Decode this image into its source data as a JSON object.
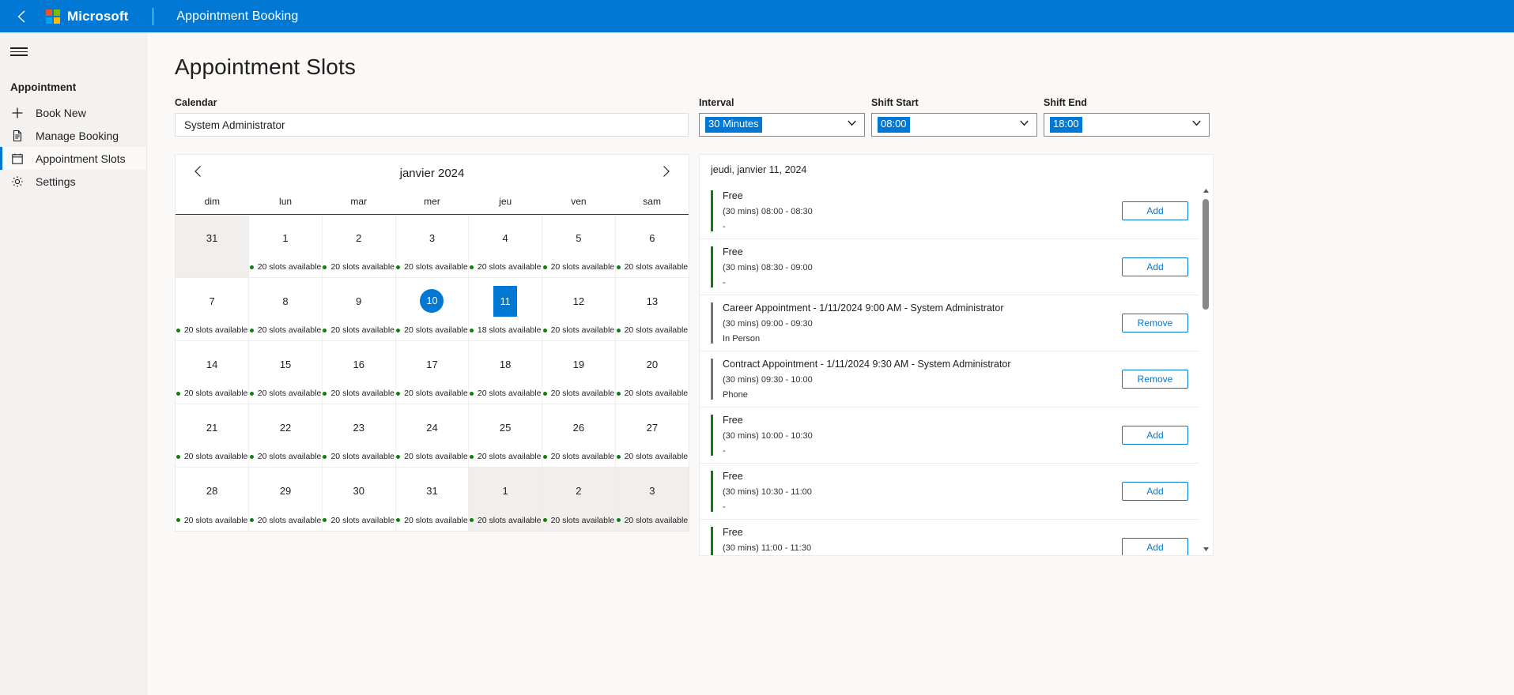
{
  "topbar": {
    "back_icon": "chevron-left-icon",
    "brand": "Microsoft",
    "app_title": "Appointment Booking"
  },
  "sidebar": {
    "menu_icon": "hamburger-menu-icon",
    "group_title": "Appointment",
    "items": [
      {
        "label": "Book New",
        "icon": "plus-icon",
        "active": false
      },
      {
        "label": "Manage Booking",
        "icon": "document-icon",
        "active": false
      },
      {
        "label": "Appointment Slots",
        "icon": "calendar-icon",
        "active": true
      },
      {
        "label": "Settings",
        "icon": "gear-icon",
        "active": false
      }
    ]
  },
  "page": {
    "title": "Appointment Slots"
  },
  "controls": {
    "calendar": {
      "label": "Calendar",
      "value": "System Administrator"
    },
    "interval": {
      "label": "Interval",
      "value": "30 Minutes"
    },
    "shift_start": {
      "label": "Shift Start",
      "value": "08:00"
    },
    "shift_end": {
      "label": "Shift End",
      "value": "18:00"
    }
  },
  "calendar": {
    "month_label": "janvier 2024",
    "prev_icon": "chevron-left-icon",
    "next_icon": "chevron-right-icon",
    "weekdays": [
      "dim",
      "lun",
      "mar",
      "mer",
      "jeu",
      "ven",
      "sam"
    ],
    "slots_text_default": "20 slots available",
    "weeks": [
      [
        {
          "day": "31",
          "othermonth": true,
          "slots": ""
        },
        {
          "day": "1",
          "othermonth": false,
          "slots": "20 slots available"
        },
        {
          "day": "2",
          "othermonth": false,
          "slots": "20 slots available"
        },
        {
          "day": "3",
          "othermonth": false,
          "slots": "20 slots available"
        },
        {
          "day": "4",
          "othermonth": false,
          "slots": "20 slots available"
        },
        {
          "day": "5",
          "othermonth": false,
          "slots": "20 slots available"
        },
        {
          "day": "6",
          "othermonth": false,
          "slots": "20 slots available"
        }
      ],
      [
        {
          "day": "7",
          "othermonth": false,
          "slots": "20 slots available"
        },
        {
          "day": "8",
          "othermonth": false,
          "slots": "20 slots available"
        },
        {
          "day": "9",
          "othermonth": false,
          "slots": "20 slots available"
        },
        {
          "day": "10",
          "othermonth": false,
          "slots": "20 slots available",
          "today": true
        },
        {
          "day": "11",
          "othermonth": false,
          "slots": "18 slots available",
          "selected": true
        },
        {
          "day": "12",
          "othermonth": false,
          "slots": "20 slots available"
        },
        {
          "day": "13",
          "othermonth": false,
          "slots": "20 slots available"
        }
      ],
      [
        {
          "day": "14",
          "othermonth": false,
          "slots": "20 slots available"
        },
        {
          "day": "15",
          "othermonth": false,
          "slots": "20 slots available"
        },
        {
          "day": "16",
          "othermonth": false,
          "slots": "20 slots available"
        },
        {
          "day": "17",
          "othermonth": false,
          "slots": "20 slots available"
        },
        {
          "day": "18",
          "othermonth": false,
          "slots": "20 slots available"
        },
        {
          "day": "19",
          "othermonth": false,
          "slots": "20 slots available"
        },
        {
          "day": "20",
          "othermonth": false,
          "slots": "20 slots available"
        }
      ],
      [
        {
          "day": "21",
          "othermonth": false,
          "slots": "20 slots available"
        },
        {
          "day": "22",
          "othermonth": false,
          "slots": "20 slots available"
        },
        {
          "day": "23",
          "othermonth": false,
          "slots": "20 slots available"
        },
        {
          "day": "24",
          "othermonth": false,
          "slots": "20 slots available"
        },
        {
          "day": "25",
          "othermonth": false,
          "slots": "20 slots available"
        },
        {
          "day": "26",
          "othermonth": false,
          "slots": "20 slots available"
        },
        {
          "day": "27",
          "othermonth": false,
          "slots": "20 slots available"
        }
      ],
      [
        {
          "day": "28",
          "othermonth": false,
          "slots": "20 slots available"
        },
        {
          "day": "29",
          "othermonth": false,
          "slots": "20 slots available"
        },
        {
          "day": "30",
          "othermonth": false,
          "slots": "20 slots available"
        },
        {
          "day": "31",
          "othermonth": false,
          "slots": "20 slots available"
        },
        {
          "day": "1",
          "othermonth": true,
          "slots": "20 slots available"
        },
        {
          "day": "2",
          "othermonth": true,
          "slots": "20 slots available"
        },
        {
          "day": "3",
          "othermonth": true,
          "slots": "20 slots available"
        }
      ]
    ]
  },
  "slot_list": {
    "date_header": "jeudi, janvier 11, 2024",
    "rows": [
      {
        "title": "Free",
        "time": "(30 mins) 08:00 - 08:30",
        "meta": "-",
        "state": "free",
        "action": "Add"
      },
      {
        "title": "Free",
        "time": "(30 mins) 08:30 - 09:00",
        "meta": "-",
        "state": "free",
        "action": "Add"
      },
      {
        "title": "Career Appointment - 1/11/2024 9:00 AM  - System Administrator",
        "time": "(30 mins) 09:00 - 09:30",
        "meta": "In Person",
        "state": "booked",
        "action": "Remove"
      },
      {
        "title": "Contract Appointment - 1/11/2024 9:30 AM  - System Administrator",
        "time": "(30 mins) 09:30 - 10:00",
        "meta": "Phone",
        "state": "booked",
        "action": "Remove"
      },
      {
        "title": "Free",
        "time": "(30 mins) 10:00 - 10:30",
        "meta": "-",
        "state": "free",
        "action": "Add"
      },
      {
        "title": "Free",
        "time": "(30 mins) 10:30 - 11:00",
        "meta": "-",
        "state": "free",
        "action": "Add"
      },
      {
        "title": "Free",
        "time": "(30 mins) 11:00 - 11:30",
        "meta": "-",
        "state": "free",
        "action": "Add"
      }
    ],
    "scrollbar": {
      "up_icon": "scroll-up-arrow-icon",
      "down_icon": "scroll-down-arrow-icon"
    }
  },
  "colors": {
    "brand_blue": "#0078d4",
    "free_green": "#107c10",
    "booked_gray": "#797775",
    "page_bg": "#faf9f8",
    "sidebar_bg": "#f3f2f1"
  }
}
